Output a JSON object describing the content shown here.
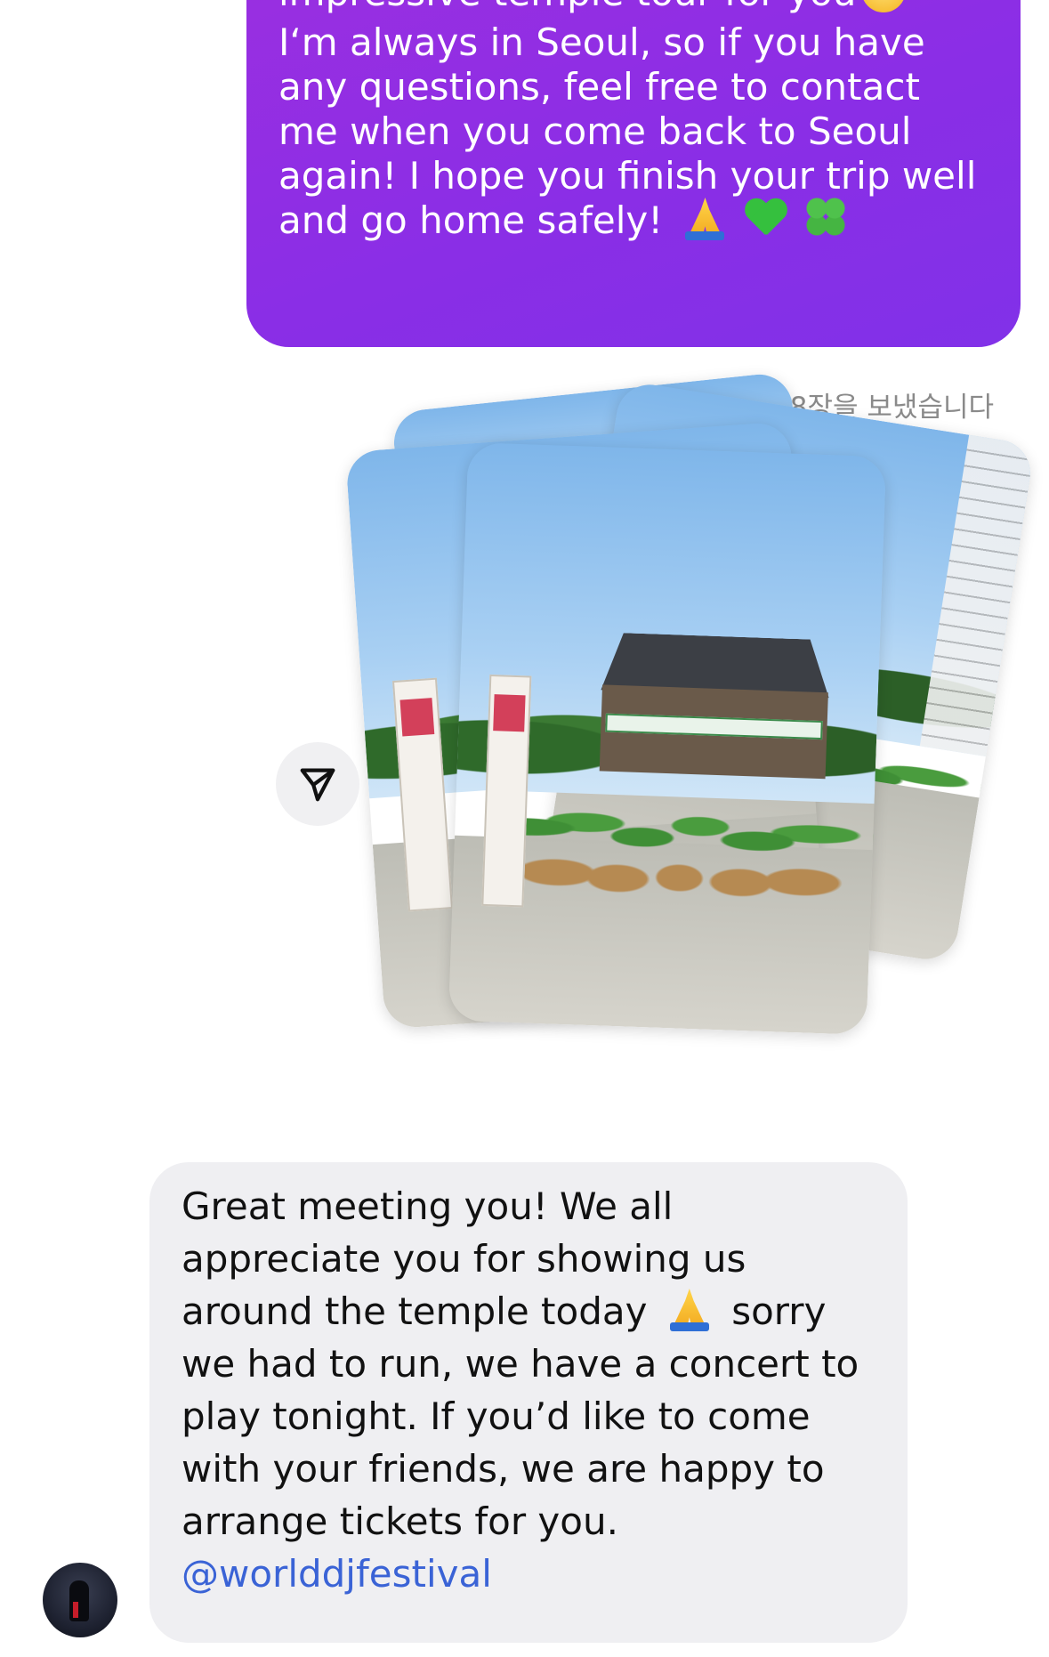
{
  "outgoing_message": {
    "lines": [
      "impressive temple tour for you",
      " I‘m always in Seoul, so if you have",
      "any questions, feel free to contact",
      "me when you come back to Seoul",
      "again! I hope you finish your trip well",
      "and go home safely!"
    ],
    "emojis": [
      "pleading-face-emoji",
      "folded-hands-emoji",
      "green-heart-emoji",
      "four-leaf-clover-emoji"
    ],
    "color": "#8a2ee6"
  },
  "photo_message": {
    "label": "사진 8장을 보냈습니다",
    "icons": {
      "share": "share-icon"
    }
  },
  "incoming_message": {
    "lines": [
      "Great meeting you! We all",
      "appreciate you for showing us",
      "around the temple today",
      "sorry",
      "we had to run, we have a concert to",
      "play tonight. If you’d like to come",
      "with your friends, we are happy to",
      "arrange tickets for you."
    ],
    "mention": "@worlddjfestival",
    "emojis": [
      "folded-hands-emoji"
    ],
    "mention_color": "#3a63d6"
  },
  "sender": {
    "avatar_icon": "avatar-icon"
  }
}
